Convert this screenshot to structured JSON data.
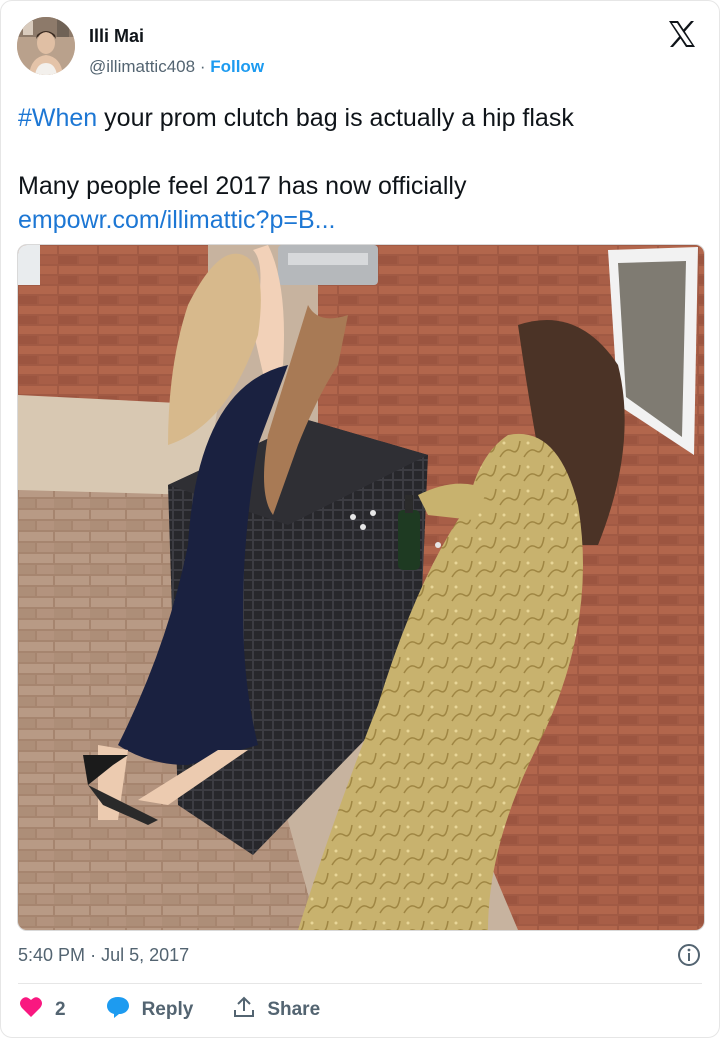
{
  "author": {
    "display_name": "Illi Mai",
    "handle": "@illimattic408",
    "separator": "·",
    "follow_label": "Follow"
  },
  "tweet": {
    "hashtag": "#When",
    "line1_rest": " your prom clutch bag is actually a hip flask",
    "line2": "Many people feel 2017 has now officially",
    "link": "empowr.com/illimattic?p=B..."
  },
  "meta": {
    "time": "5:40 PM",
    "separator": "·",
    "date": "Jul 5, 2017"
  },
  "actions": {
    "like_count": "2",
    "reply_label": "Reply",
    "share_label": "Share"
  },
  "colors": {
    "accent": "#1d9bf0",
    "like": "#f91880",
    "text": "#0f1419",
    "muted": "#536471"
  },
  "icons": [
    "x-logo-icon",
    "info-icon",
    "heart-icon",
    "reply-bubble-icon",
    "share-icon"
  ]
}
